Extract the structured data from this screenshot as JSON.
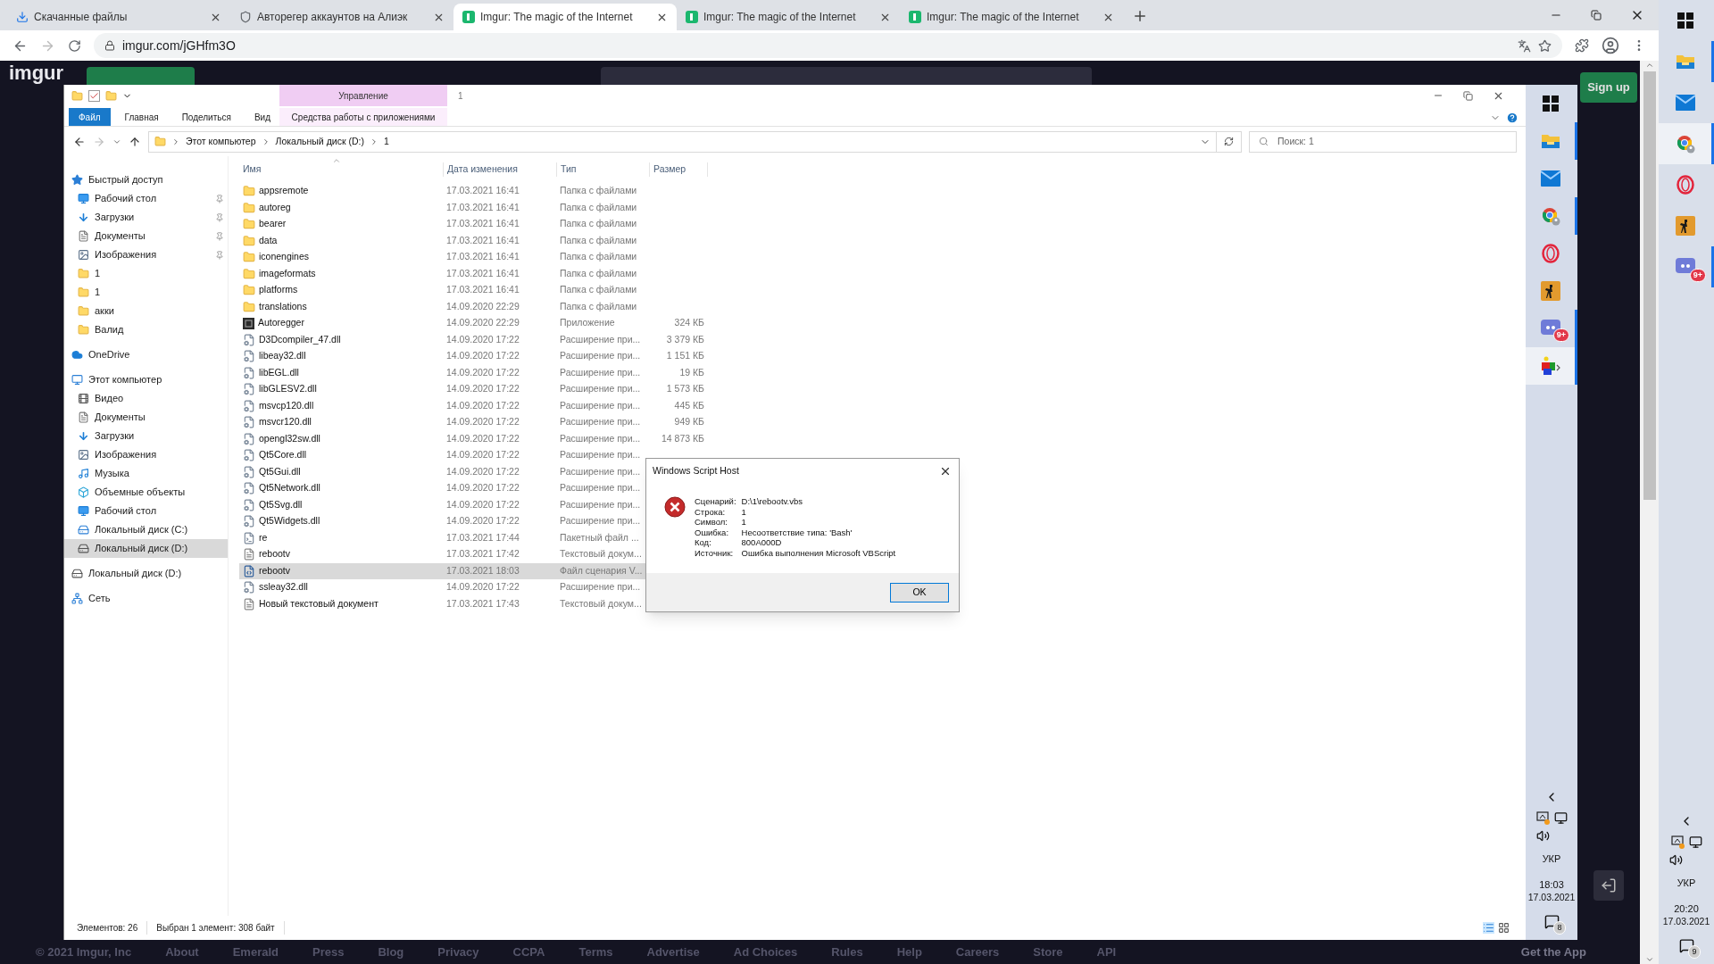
{
  "browser": {
    "tabs": [
      {
        "title": "Скачанные файлы",
        "kind": "download",
        "selected": false
      },
      {
        "title": "Авторегер аккаунтов на Алиэк",
        "kind": "shield",
        "selected": false
      },
      {
        "title": "Imgur: The magic of the Internet",
        "kind": "imgur",
        "selected": true
      },
      {
        "title": "Imgur: The magic of the Internet",
        "kind": "imgur",
        "selected": false
      },
      {
        "title": "Imgur: The magic of the Internet",
        "kind": "imgur",
        "selected": false
      }
    ],
    "url": "imgur.com/jGHfm3O"
  },
  "imgur": {
    "logo": "imgur",
    "signup": "Sign up",
    "footer": [
      "© 2021 Imgur, Inc",
      "About",
      "Emerald",
      "Press",
      "Blog",
      "Privacy",
      "CCPA",
      "Terms",
      "Advertise",
      "Ad Choices",
      "Rules",
      "Help",
      "Careers",
      "Store",
      "API"
    ],
    "get_app": "Get the App"
  },
  "explorer": {
    "contextual_group": "Управление",
    "title": "1",
    "ribbon_tabs": [
      {
        "label": "Файл",
        "kind": "file"
      },
      {
        "label": "Главная",
        "kind": "tab"
      },
      {
        "label": "Поделиться",
        "kind": "tab"
      },
      {
        "label": "Вид",
        "kind": "tab"
      },
      {
        "label": "Средства работы с приложениями",
        "kind": "contextual"
      }
    ],
    "breadcrumb": [
      "Этот компьютер",
      "Локальный диск (D:)",
      "1"
    ],
    "search_placeholder": "Поиск: 1",
    "nav": [
      {
        "label": "Быстрый доступ",
        "kind": "star",
        "pinned": false,
        "selected": false,
        "children": [
          {
            "label": "Рабочий стол",
            "kind": "desktop",
            "pinned": true,
            "selected": false
          },
          {
            "label": "Загрузки",
            "kind": "download",
            "pinned": true,
            "selected": false
          },
          {
            "label": "Документы",
            "kind": "docs",
            "pinned": true,
            "selected": false
          },
          {
            "label": "Изображения",
            "kind": "images",
            "pinned": true,
            "selected": false
          },
          {
            "label": "1",
            "kind": "folder",
            "pinned": false,
            "selected": false
          },
          {
            "label": "1",
            "kind": "folder",
            "pinned": false,
            "selected": false
          },
          {
            "label": "акки",
            "kind": "folder",
            "pinned": false,
            "selected": false
          },
          {
            "label": "Валид",
            "kind": "folder",
            "pinned": false,
            "selected": false
          }
        ]
      },
      {
        "label": "OneDrive",
        "kind": "cloud",
        "pinned": false,
        "selected": false
      },
      {
        "label": "Этот компьютер",
        "kind": "pc",
        "pinned": false,
        "selected": false,
        "children": [
          {
            "label": "Видео",
            "kind": "video",
            "pinned": false,
            "selected": false
          },
          {
            "label": "Документы",
            "kind": "docs",
            "pinned": false,
            "selected": false
          },
          {
            "label": "Загрузки",
            "kind": "download",
            "pinned": false,
            "selected": false
          },
          {
            "label": "Изображения",
            "kind": "images",
            "pinned": false,
            "selected": false
          },
          {
            "label": "Музыка",
            "kind": "music",
            "pinned": false,
            "selected": false
          },
          {
            "label": "Объемные объекты",
            "kind": "objects",
            "pinned": false,
            "selected": false
          },
          {
            "label": "Рабочий стол",
            "kind": "desktop",
            "pinned": false,
            "selected": false
          },
          {
            "label": "Локальный диск (C:)",
            "kind": "system",
            "pinned": false,
            "selected": false
          },
          {
            "label": "Локальный диск (D:)",
            "kind": "disk",
            "pinned": false,
            "selected": true
          }
        ]
      },
      {
        "label": "Локальный диск (D:)",
        "kind": "disk",
        "pinned": false,
        "selected": false
      },
      {
        "label": "Сеть",
        "kind": "network",
        "pinned": false,
        "selected": false
      }
    ],
    "columns": [
      "Имя",
      "Дата изменения",
      "Тип",
      "Размер"
    ],
    "files": [
      {
        "name": "appsremote",
        "date": "17.03.2021 16:41",
        "type": "Папка с файлами",
        "kind": "folder",
        "selected": false
      },
      {
        "name": "autoreg",
        "date": "17.03.2021 16:41",
        "type": "Папка с файлами",
        "kind": "folder",
        "selected": false
      },
      {
        "name": "bearer",
        "date": "17.03.2021 16:41",
        "type": "Папка с файлами",
        "kind": "folder",
        "selected": false
      },
      {
        "name": "data",
        "date": "17.03.2021 16:41",
        "type": "Папка с файлами",
        "kind": "folder",
        "selected": false
      },
      {
        "name": "iconengines",
        "date": "17.03.2021 16:41",
        "type": "Папка с файлами",
        "kind": "folder",
        "selected": false
      },
      {
        "name": "imageformats",
        "date": "17.03.2021 16:41",
        "type": "Папка с файлами",
        "kind": "folder",
        "selected": false
      },
      {
        "name": "platforms",
        "date": "17.03.2021 16:41",
        "type": "Папка с файлами",
        "kind": "folder",
        "selected": false
      },
      {
        "name": "translations",
        "date": "14.09.2020 22:29",
        "type": "Папка с файлами",
        "kind": "folder",
        "selected": false
      },
      {
        "name": "Autoregger",
        "date": "14.09.2020 22:29",
        "type": "Приложение",
        "size": "324 КБ",
        "kind": "app",
        "selected": false
      },
      {
        "name": "D3Dcompiler_47.dll",
        "date": "14.09.2020 17:22",
        "type": "Расширение при...",
        "size": "3 379 КБ",
        "kind": "dll",
        "selected": false
      },
      {
        "name": "libeay32.dll",
        "date": "14.09.2020 17:22",
        "type": "Расширение при...",
        "size": "1 151 КБ",
        "kind": "dll",
        "selected": false
      },
      {
        "name": "libEGL.dll",
        "date": "14.09.2020 17:22",
        "type": "Расширение при...",
        "size": "19 КБ",
        "kind": "dll",
        "selected": false
      },
      {
        "name": "libGLESV2.dll",
        "date": "14.09.2020 17:22",
        "type": "Расширение при...",
        "size": "1 573 КБ",
        "kind": "dll",
        "selected": false
      },
      {
        "name": "msvcp120.dll",
        "date": "14.09.2020 17:22",
        "type": "Расширение при...",
        "size": "445 КБ",
        "kind": "dll",
        "selected": false
      },
      {
        "name": "msvcr120.dll",
        "date": "14.09.2020 17:22",
        "type": "Расширение при...",
        "size": "949 КБ",
        "kind": "dll",
        "selected": false
      },
      {
        "name": "opengl32sw.dll",
        "date": "14.09.2020 17:22",
        "type": "Расширение при...",
        "size": "14 873 КБ",
        "kind": "dll",
        "selected": false
      },
      {
        "name": "Qt5Core.dll",
        "date": "14.09.2020 17:22",
        "type": "Расширение при...",
        "kind": "dll",
        "selected": false
      },
      {
        "name": "Qt5Gui.dll",
        "date": "14.09.2020 17:22",
        "type": "Расширение при...",
        "kind": "dll",
        "selected": false
      },
      {
        "name": "Qt5Network.dll",
        "date": "14.09.2020 17:22",
        "type": "Расширение при...",
        "kind": "dll",
        "selected": false
      },
      {
        "name": "Qt5Svg.dll",
        "date": "14.09.2020 17:22",
        "type": "Расширение при...",
        "kind": "dll",
        "selected": false
      },
      {
        "name": "Qt5Widgets.dll",
        "date": "14.09.2020 17:22",
        "type": "Расширение при...",
        "kind": "dll",
        "selected": false
      },
      {
        "name": "re",
        "date": "17.03.2021 17:44",
        "type": "Пакетный файл ...",
        "kind": "bat",
        "selected": false
      },
      {
        "name": "rebootv",
        "date": "17.03.2021 17:42",
        "type": "Текстовый докум...",
        "kind": "txt",
        "selected": false
      },
      {
        "name": "rebootv",
        "date": "17.03.2021 18:03",
        "type": "Файл сценария V...",
        "kind": "vbs",
        "selected": true
      },
      {
        "name": "ssleay32.dll",
        "date": "14.09.2020 17:22",
        "type": "Расширение при...",
        "kind": "dll",
        "selected": false
      },
      {
        "name": "Новый текстовый документ",
        "date": "17.03.2021 17:43",
        "type": "Текстовый докум...",
        "kind": "txt",
        "selected": false
      }
    ],
    "status": [
      "Элементов: 26",
      "Выбран 1 элемент: 308 байт"
    ]
  },
  "dialog": {
    "title": "Windows Script Host",
    "lines": [
      {
        "label": "Сценарий:",
        "value": "D:\\1\\rebootv.vbs"
      },
      {
        "label": "Строка:",
        "value": "1"
      },
      {
        "label": "Символ:",
        "value": "1"
      },
      {
        "label": "Ошибка:",
        "value": "Несоответствие типа: 'Bash'"
      },
      {
        "label": "Код:",
        "value": "800A000D"
      },
      {
        "label": "Источник:",
        "value": "Ошибка выполнения Microsoft VBScript"
      }
    ],
    "button": "OK"
  },
  "inner_taskbar": {
    "apps": [
      {
        "kind": "start",
        "active": false,
        "selected": false
      },
      {
        "kind": "explorer",
        "active": true,
        "selected": false
      },
      {
        "kind": "mail",
        "active": false,
        "selected": false
      },
      {
        "kind": "chrome",
        "active": true,
        "selected": false
      },
      {
        "kind": "opera",
        "active": false,
        "selected": false
      },
      {
        "kind": "game",
        "active": false,
        "selected": false
      },
      {
        "kind": "chat",
        "active": true,
        "selected": false,
        "badge": "9+"
      },
      {
        "kind": "cube",
        "active": true,
        "selected": true
      }
    ],
    "language": "УКР",
    "time": "18:03",
    "date": "17.03.2021",
    "notifications": "8"
  },
  "taskbar": {
    "apps": [
      {
        "kind": "start",
        "active": false,
        "selected": false
      },
      {
        "kind": "explorer",
        "active": true,
        "selected": false
      },
      {
        "kind": "mail",
        "active": false,
        "selected": false
      },
      {
        "kind": "chrome",
        "active": true,
        "selected": true
      },
      {
        "kind": "opera",
        "active": false,
        "selected": false
      },
      {
        "kind": "game",
        "active": false,
        "selected": false
      },
      {
        "kind": "chat",
        "active": true,
        "selected": false,
        "badge": "9+"
      }
    ],
    "language": "УКР",
    "time": "20:20",
    "date": "17.03.2021",
    "notifications": "9"
  }
}
